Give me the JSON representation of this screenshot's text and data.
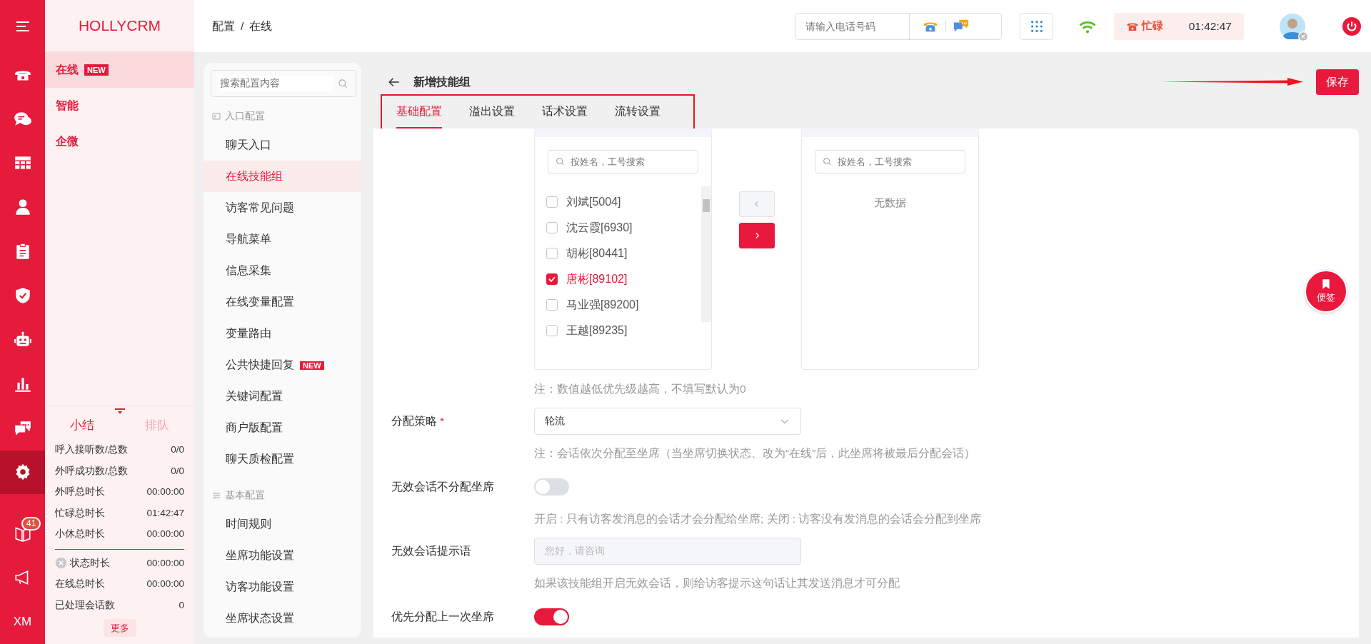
{
  "rail": {
    "items": [
      {
        "kind": "menu",
        "selected": false
      },
      {
        "kind": "phone",
        "selected": false
      },
      {
        "kind": "chat",
        "selected": false
      },
      {
        "kind": "grid",
        "selected": false
      },
      {
        "kind": "person",
        "selected": false
      },
      {
        "kind": "clipboard",
        "selected": false
      },
      {
        "kind": "shield",
        "selected": false
      },
      {
        "kind": "robot",
        "selected": false
      },
      {
        "kind": "chart",
        "selected": false
      },
      {
        "kind": "chats",
        "selected": false
      },
      {
        "kind": "gear",
        "selected": true
      },
      {
        "kind": "book",
        "selected": false,
        "badge": "41"
      },
      {
        "kind": "megaphone",
        "selected": false
      },
      {
        "kind": "text",
        "selected": false,
        "label": "XM"
      }
    ]
  },
  "brand": "HOLLYCRM",
  "modules": [
    {
      "label": "在线",
      "badge": "NEW",
      "selected": true
    },
    {
      "label": "智能",
      "selected": false
    },
    {
      "label": "企微",
      "selected": false
    }
  ],
  "stats": {
    "tabs": [
      {
        "label": "小结",
        "selected": true
      },
      {
        "label": "排队",
        "selected": false
      }
    ],
    "groups": [
      [
        {
          "kind": "plain",
          "label": "呼入接听数/总数",
          "value": "0/0"
        },
        {
          "kind": "plain",
          "label": "外呼成功数/总数",
          "value": "0/0"
        },
        {
          "kind": "plain",
          "label": "外呼总时长",
          "value": "00:00:00"
        },
        {
          "kind": "plain",
          "label": "忙碌总时长",
          "value": "01:42:47"
        },
        {
          "kind": "plain",
          "label": "小休总时长",
          "value": "00:00:00"
        }
      ],
      [
        {
          "kind": "status",
          "label": "状态时长",
          "value": "00:00:00"
        },
        {
          "kind": "plain",
          "label": "在线总时长",
          "value": "00:00:00"
        },
        {
          "kind": "plain",
          "label": "已处理会话数",
          "value": "0"
        }
      ]
    ],
    "more": "更多"
  },
  "breadcrumb": {
    "items": [
      "配置",
      "在线"
    ],
    "separator": "/"
  },
  "topbar": {
    "phone_placeholder": "请输入电话号码",
    "status": "忙碌",
    "timer": "01:42:47"
  },
  "config_menu": {
    "search_placeholder": "搜索配置内容",
    "sections": [
      {
        "kind": "entry",
        "title": "入口配置",
        "items": [
          {
            "label": "聊天入口",
            "selected": false
          },
          {
            "label": "在线技能组",
            "selected": true
          },
          {
            "label": "访客常见问题",
            "selected": false
          },
          {
            "label": "导航菜单",
            "selected": false
          },
          {
            "label": "信息采集",
            "selected": false
          },
          {
            "label": "在线变量配置",
            "selected": false
          },
          {
            "label": "变量路由",
            "selected": false
          },
          {
            "label": "公共快捷回复",
            "selected": false,
            "badge": "NEW"
          },
          {
            "label": "关键词配置",
            "selected": false
          },
          {
            "label": "商户版配置",
            "selected": false
          },
          {
            "label": "聊天质检配置",
            "selected": false
          }
        ]
      },
      {
        "kind": "basic",
        "title": "基本配置",
        "items": [
          {
            "label": "时间规则",
            "selected": false
          },
          {
            "label": "坐席功能设置",
            "selected": false
          },
          {
            "label": "访客功能设置",
            "selected": false
          },
          {
            "label": "坐席状态设置",
            "selected": false
          }
        ]
      }
    ]
  },
  "page": {
    "title": "新增技能组",
    "save": "保存",
    "tabs": [
      {
        "label": "基础配置",
        "selected": true
      },
      {
        "label": "溢出设置",
        "selected": false
      },
      {
        "label": "话术设置",
        "selected": false
      },
      {
        "label": "流转设置",
        "selected": false
      }
    ]
  },
  "transfer": {
    "left": {
      "search_placeholder": "按姓名，工号搜索",
      "items": [
        {
          "label": "刘斌[5004]",
          "checked": false
        },
        {
          "label": "沈云霞[6930]",
          "checked": false
        },
        {
          "label": "胡彬[80441]",
          "checked": false
        },
        {
          "label": "唐彬[89102]",
          "checked": true
        },
        {
          "label": "马业强[89200]",
          "checked": false
        },
        {
          "label": "王越[89235]",
          "checked": false
        }
      ]
    },
    "to_left_disabled": true,
    "to_right_disabled": false,
    "right": {
      "search_placeholder": "按姓名，工号搜索",
      "empty": "无数据"
    }
  },
  "form": [
    {
      "kind": "note",
      "text": "注：数值越低优先级越高，不填写默认为0"
    },
    {
      "kind": "select",
      "label": "分配策略",
      "required_mark": "*",
      "value": "轮流"
    },
    {
      "kind": "note",
      "text": "注：会话依次分配至坐席（当坐席切换状态、改为“在线”后，此坐席将被最后分配会话）"
    },
    {
      "kind": "toggle",
      "label": "无效会话不分配坐席",
      "on": false
    },
    {
      "kind": "note",
      "text": "开启 : 只有访客发消息的会话才会分配给坐席; 关闭 : 访客没有发消息的会话会分配到坐席"
    },
    {
      "kind": "input",
      "label": "无效会话提示语",
      "placeholder": "您好，请咨询"
    },
    {
      "kind": "note",
      "text": "如果该技能组开启无效会话，则给访客提示这句话让其发送消息才可分配"
    },
    {
      "kind": "toggle",
      "label": "优先分配上一次坐席",
      "on": true
    }
  ],
  "float_button": "便签"
}
